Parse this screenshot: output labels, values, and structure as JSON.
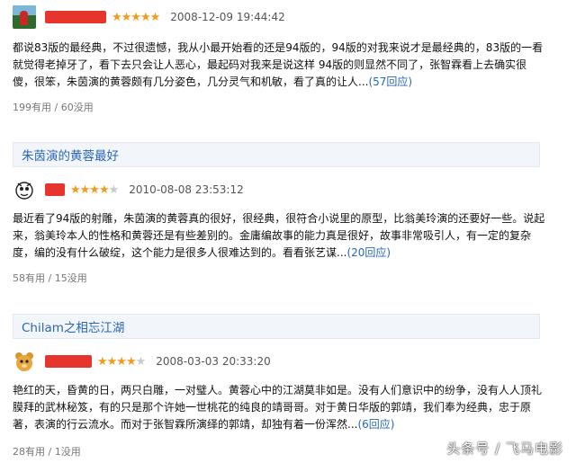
{
  "reviews": [
    {
      "date": "2008-12-09 19:44:42",
      "rating": 5,
      "lines": [
        "都说83版的最经典，不过很遗憾，我从小最开始看的还是94版的，94版的对我来说才是最经典的，83版的一看",
        "就觉得老掉牙了，看下去只会让人恶心，最起码对我来是说这样 94版的则显然不同了，张智霖看上去确实很",
        "傻，很笨，朱茵演的黄蓉颇有几分姿色，几分灵气和机敏，看了真的让人..."
      ],
      "more": "(57回应)",
      "votes": "199有用 / 60没用"
    },
    {
      "title": "朱茵演的黄蓉最好",
      "date": "2010-08-08 23:53:12",
      "rating": 4,
      "lines": [
        "最近看了94版的射雕，朱茵演的黄蓉真的很好，很经典，很符合小说里的原型，比翁美玲演的还要好一些。说起",
        "来，翁美玲本人的性格和黄蓉还是有些差别的。金庸编故事的能力真是很好，故事非常吸引人，有一定的复杂",
        "度，编的没有什么破绽，这个能力是很多人很难达到的。看看张艺谋..."
      ],
      "more": "(20回应)",
      "votes": "58有用 / 15没用"
    },
    {
      "title": "Chilam之相忘江湖",
      "date": "2008-03-03 20:33:20",
      "rating": 4,
      "lines": [
        "艳红的天，昏黄的日，两只白雕，一对璧人。黄蓉心中的江湖莫非如是。没有人们意识中的纷争，没有人人顶礼",
        "膜拜的武林秘笈，有的只是那个许她一世桃花的纯良的靖哥哥。对于黄日华版的郭靖，我们奉为经典，忠于原",
        "著，表演的行云流水。而对于张智霖所演绎的郭靖，却独有着一份浑然..."
      ],
      "more": "(6回应)",
      "votes": "28有用 / 1没用"
    }
  ],
  "watermark": "头条号 / 飞马电影",
  "colors": {
    "star": "#f39a1b",
    "link": "#2a67b5",
    "redact": "#e5352c"
  }
}
